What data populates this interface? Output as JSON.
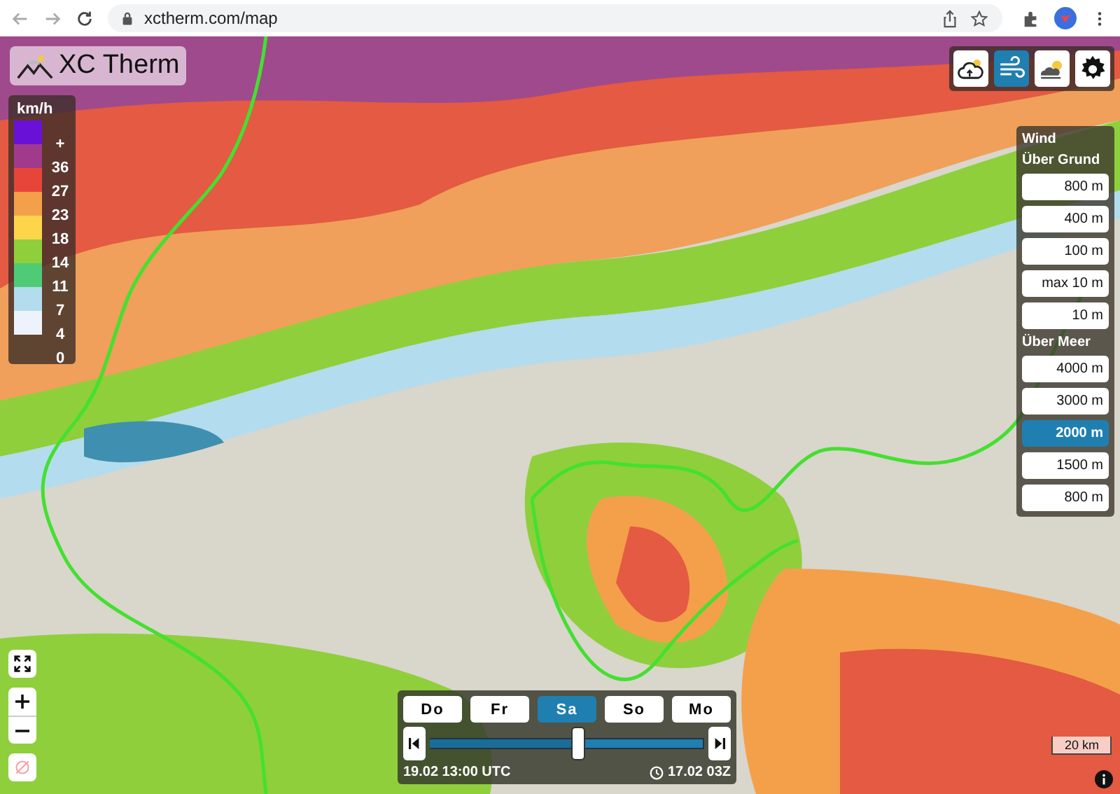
{
  "browser": {
    "url": "xctherm.com/map"
  },
  "logo": {
    "text": "XC Therm"
  },
  "legend": {
    "unit": "km/h",
    "steps": [
      {
        "label": "+",
        "color": "#6a11d8"
      },
      {
        "label": "36",
        "color": "#a23a8c"
      },
      {
        "label": "27",
        "color": "#e8453a"
      },
      {
        "label": "23",
        "color": "#f4a04a"
      },
      {
        "label": "18",
        "color": "#fdd54a"
      },
      {
        "label": "14",
        "color": "#8fcf3c"
      },
      {
        "label": "11",
        "color": "#4fcb75"
      },
      {
        "label": "7",
        "color": "#b3dcee"
      },
      {
        "label": "4",
        "color": "#eef3fb"
      },
      {
        "label": "0"
      }
    ]
  },
  "layers": [
    {
      "kind": "thermal",
      "selected": false
    },
    {
      "kind": "wind",
      "selected": true
    },
    {
      "kind": "clouds",
      "selected": false
    },
    {
      "kind": "settings",
      "selected": false
    }
  ],
  "wind_panel": {
    "title": "Wind",
    "groups": [
      {
        "title": "Über Grund",
        "levels": [
          {
            "label": "800 m",
            "selected": false
          },
          {
            "label": "400 m",
            "selected": false
          },
          {
            "label": "100 m",
            "selected": false
          },
          {
            "label": "max 10 m",
            "selected": false
          },
          {
            "label": "10 m",
            "selected": false
          }
        ]
      },
      {
        "title": "Über Meer",
        "levels": [
          {
            "label": "4000 m",
            "selected": false
          },
          {
            "label": "3000 m",
            "selected": false
          },
          {
            "label": "2000 m",
            "selected": true
          },
          {
            "label": "1500 m",
            "selected": false
          },
          {
            "label": "800 m",
            "selected": false
          }
        ]
      }
    ]
  },
  "days": [
    {
      "label": "Do",
      "selected": false
    },
    {
      "label": "Fr",
      "selected": false
    },
    {
      "label": "Sa",
      "selected": true
    },
    {
      "label": "So",
      "selected": false
    },
    {
      "label": "Mo",
      "selected": false
    }
  ],
  "timeline": {
    "level": 0.54,
    "time": "19.02 13:00 UTC",
    "run": "17.02 03Z"
  },
  "scale": "20 km"
}
